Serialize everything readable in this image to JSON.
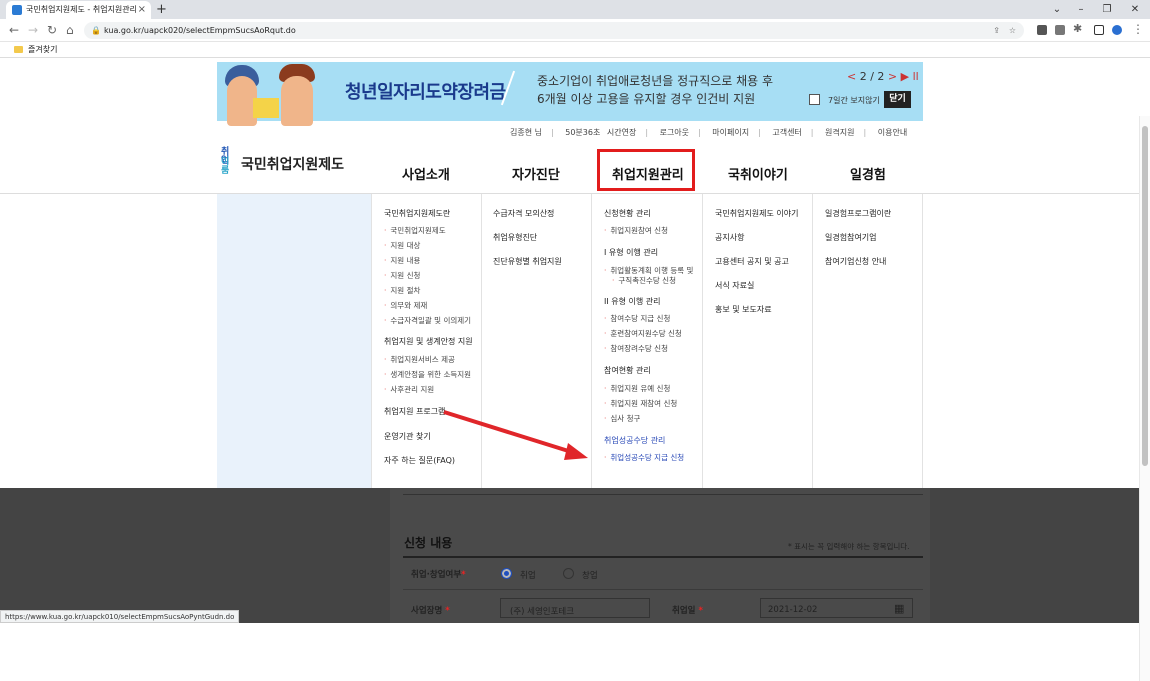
{
  "browser": {
    "tab_title": "국민취업지원제도 - 취업지원관리",
    "new_tab": "+",
    "url": "kua.go.kr/uapck020/selectEmpmSucsAoRqut.do",
    "bookmark_folder": "즐겨찾기",
    "status_url": "https://www.kua.go.kr/uapck010/selectEmpmSucsAoPyntGudn.do",
    "icons": [
      "back-icon",
      "forward-icon",
      "reload-icon",
      "home-icon",
      "lock-icon",
      "share-icon",
      "star-icon",
      "extension-icon",
      "profile-icon"
    ]
  },
  "banner": {
    "title": "청년일자리도약장려금",
    "desc_line1": "중소기업이 취업애로청년을 정규직으로 채용 후",
    "desc_line2": "6개월 이상 고용을 유지할 경우 인건비 지원",
    "pager": "2 / 2",
    "prev": "<",
    "next": ">",
    "play_pause": "▶ ll",
    "hide_7days": "7일간 보지않기",
    "close": "닫기"
  },
  "util_nav": [
    "김종현 님",
    "50분36초",
    "시간연장",
    "로그아웃",
    "마이페이지",
    "고객센터",
    "원격지원",
    "이용안내"
  ],
  "logo": {
    "small_top": "취업",
    "small_bottom": "이룸",
    "name": "국민취업지원제도"
  },
  "gnb": [
    "사업소개",
    "자가진단",
    "취업지원관리",
    "국취이야기",
    "일경험"
  ],
  "dropdown": {
    "col1": {
      "h1": "국민취업지원제도란",
      "sub1": [
        "국민취업지원제도",
        "지원 대상",
        "지원 내용",
        "지원 신청",
        "지원 절차",
        "의무와 제재",
        "수급자격일괄 및 이의제기"
      ],
      "h2": "취업지원 및 생계안정 지원",
      "sub2": [
        "취업지원서비스 제공",
        "생계안정을 위한 소득지원",
        "사후관리 지원"
      ],
      "h3": "취업지원 프로그램",
      "h4": "운영기관 찾기",
      "h5": "자주 하는 질문(FAQ)"
    },
    "col2": [
      "수급자격 모의산정",
      "취업유형진단",
      "진단유형별 취업지원"
    ],
    "col3": {
      "h1": "신청현황 관리",
      "sub1": [
        "취업지원참여 신청"
      ],
      "h2": "I 유형 이행 관리",
      "sub2a": "취업활동계획 이행 등록 및",
      "sub2b": "구직촉진수당 신청",
      "h3": "II 유형 이행 관리",
      "sub3": [
        "참여수당 지급 신청",
        "훈련참여지원수당 신청",
        "참여장려수당 신청"
      ],
      "h4": "참여현황 관리",
      "sub4": [
        "취업지원 유예 신청",
        "취업지원 재참여 신청",
        "심사 청구"
      ],
      "h5": "취업성공수당 관리",
      "sub5": [
        "취업성공수당 지급 신청"
      ]
    },
    "col4": [
      "국민취업지원제도 이야기",
      "공지사항",
      "고용센터 공지 및 공고",
      "서식 자료실",
      "홍보 및 보도자료"
    ],
    "col5": [
      "일경험프로그램이란",
      "일경험참여기업",
      "참여기업신청 안내"
    ]
  },
  "form": {
    "section_title": "신청 내용",
    "required_note": "* 표시는 꼭 입력해야 하는 항목입니다.",
    "field1_label": "취업·창업여부",
    "opt_employ": "취업",
    "opt_startup": "창업",
    "selected": "취업",
    "field2_label": "사업장명",
    "company": "(주) 세영인포테크",
    "field3_label": "취업일",
    "date": "2021-12-02",
    "req_star": "*"
  },
  "colors": {
    "accent_red": "#e21c1c",
    "arrow": "#e0262a",
    "banner_bg": "#a7def4",
    "link_blue": "#2a4ab7"
  }
}
